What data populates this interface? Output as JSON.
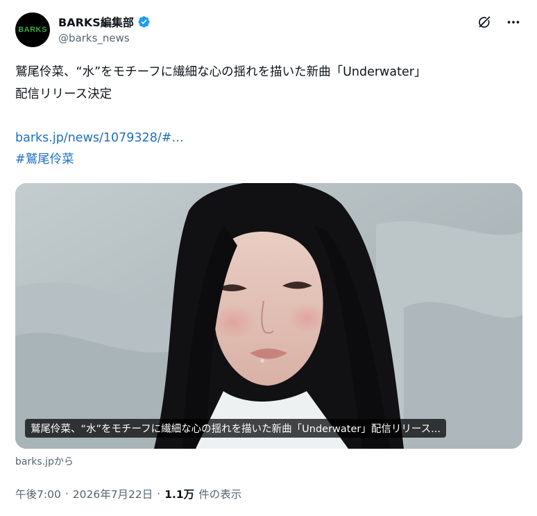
{
  "author": {
    "display_name": "BARKS編集部",
    "handle": "@barks_news",
    "avatar_text": "BARKS",
    "avatar_text_color": "#3ea843",
    "verified": true,
    "verified_color": "#1d9bf0"
  },
  "tweet": {
    "text_lines": [
      "鷲尾伶菜、“水”をモチーフに繊細な心の揺れを描いた新曲「Underwater」",
      "配信リリース決定"
    ],
    "link": "barks.jp/news/1079328/#…",
    "hashtag": "#鷲尾伶菜",
    "link_color": "#1d6fc4"
  },
  "card": {
    "caption": "鷲尾伶菜、“水”をモチーフに繊細な心の揺れを描いた新曲「Underwater」配信リリース...",
    "source": "barks.jpから"
  },
  "meta": {
    "time": "午後7:00",
    "separator": "·",
    "date": "2026年7月22日",
    "views_count": "1.1万",
    "views_label": "件の表示"
  },
  "icons": {
    "grok": "grok-icon",
    "more": "more-icon",
    "verified": "verified-badge-icon"
  }
}
